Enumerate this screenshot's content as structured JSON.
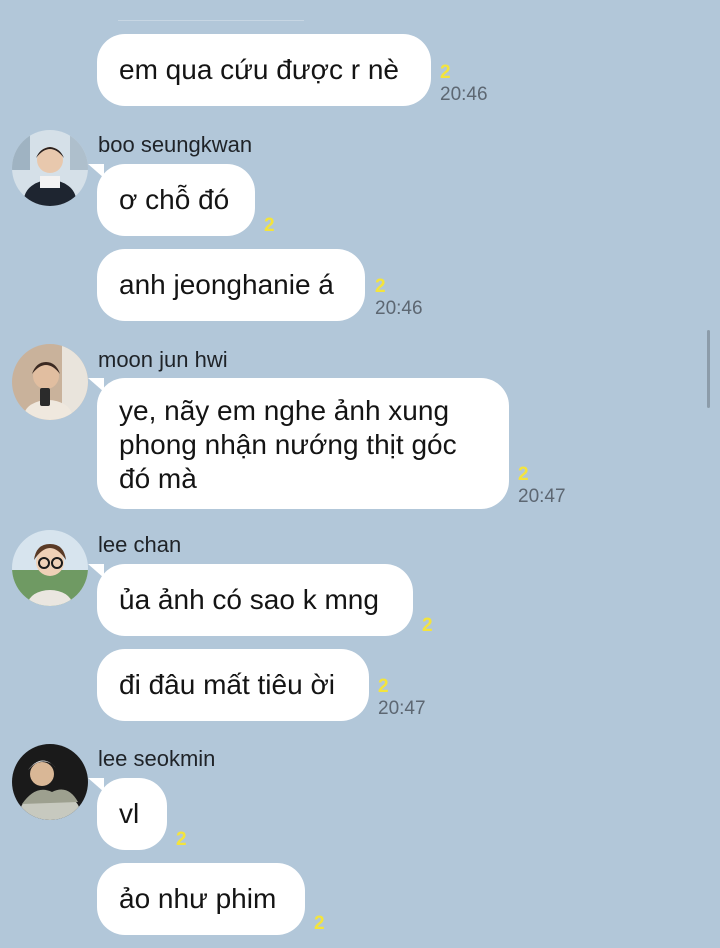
{
  "chat": {
    "messages": [
      {
        "text": "em qua cứu được r nè",
        "unread": "2",
        "time": "20:46"
      },
      {
        "sender": "boo seungkwan",
        "text": "ơ chỗ đó",
        "unread": "2",
        "time": ""
      },
      {
        "text": "anh jeonghanie á",
        "unread": "2",
        "time": "20:46"
      },
      {
        "sender": "moon jun hwi",
        "text": "ye, nãy em nghe ảnh xung phong nhận nướng thịt góc đó mà",
        "unread": "2",
        "time": "20:47"
      },
      {
        "sender": "lee chan",
        "text": "ủa ảnh có sao k mng",
        "unread": "2",
        "time": ""
      },
      {
        "text": "đi đâu mất tiêu ời",
        "unread": "2",
        "time": "20:47"
      },
      {
        "sender": "lee seokmin",
        "text": "vl",
        "unread": "2",
        "time": ""
      },
      {
        "text": "ảo như phim",
        "unread": "2",
        "time": ""
      }
    ]
  },
  "colors": {
    "background": "#b2c7d9",
    "bubble": "#ffffff",
    "unread": "#f4e43c",
    "time": "#5d6772"
  }
}
